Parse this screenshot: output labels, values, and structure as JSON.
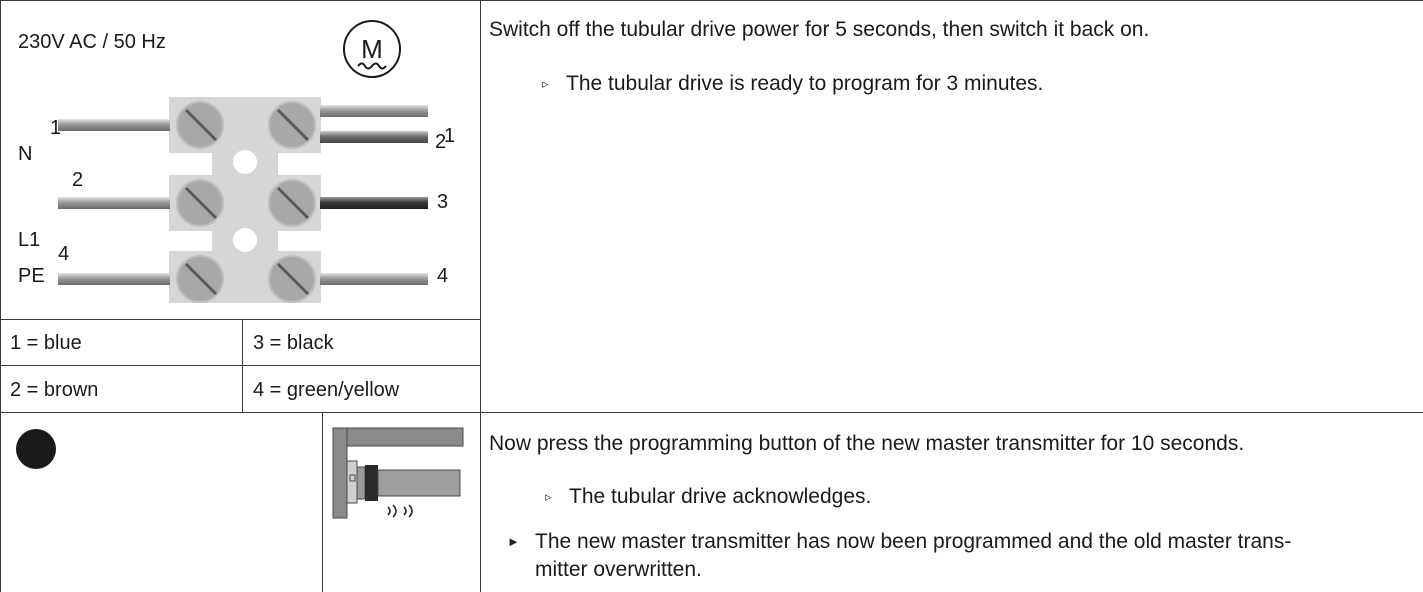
{
  "wiring": {
    "supply_label": "230V AC / 50 Hz",
    "motor_symbol": "M",
    "rows": [
      {
        "terminal": "N",
        "wire_number": "1",
        "out_numbers": [
          "1",
          "2"
        ]
      },
      {
        "terminal": "L1",
        "wire_number": "2",
        "out_numbers": [
          "3"
        ]
      },
      {
        "terminal": "PE",
        "wire_number": "4",
        "out_numbers": [
          "4"
        ]
      }
    ]
  },
  "legend": [
    {
      "left": "1 = blue",
      "right": "3 = black"
    },
    {
      "left": "2 = brown",
      "right": "4 = green/yellow"
    }
  ],
  "step1": {
    "instruction": "Switch off the tubular drive power for 5 seconds, then switch it back on.",
    "result": "The tubular drive is ready to program for 3 minutes."
  },
  "step2": {
    "instruction": "Now press the programming button of the new master transmitter for 10 seconds.",
    "result": "The tubular drive acknowledges.",
    "final_line1": "The new master transmitter has now been programmed and the old master trans-",
    "final_line2": "mitter overwritten."
  },
  "markers": {
    "result_marker": "▹",
    "final_marker": "►"
  },
  "colors": {
    "terminal_block": "#d6d6d6",
    "screw": "#9e9e9e",
    "dot": "#1a1a1a",
    "wire_grey": "#9a9a9a",
    "wire_dark": "#3a3a3a"
  }
}
